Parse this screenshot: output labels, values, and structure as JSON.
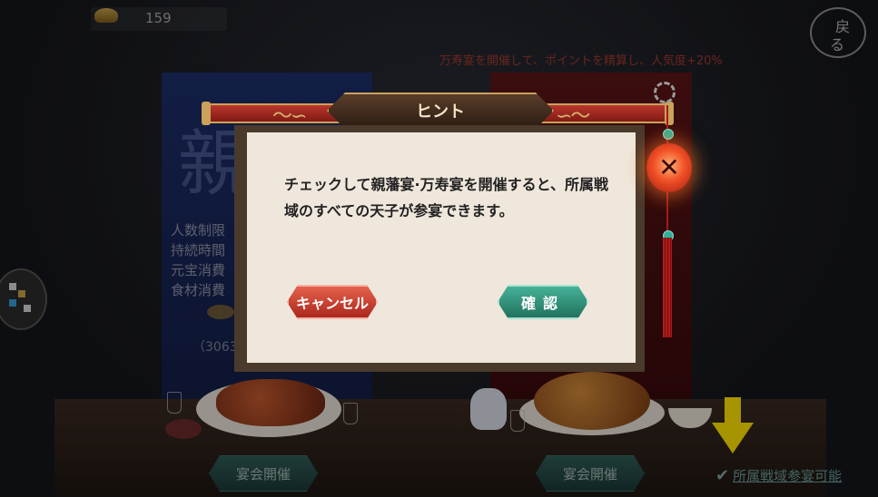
{
  "topbar": {
    "currency_value": "159",
    "notice": "万寿宴を開催して、ポイントを精算し、人気度+20%",
    "back_button_glyphs": [
      "戻",
      "る"
    ]
  },
  "banner_left": {
    "big_glyph": "親",
    "stats": [
      "人数制限",
      "持続時間",
      "元宝消費",
      "食材消費"
    ],
    "count": "（3063"
  },
  "dialog": {
    "title": "ヒント",
    "message": "チェックして親藩宴·万寿宴を開催すると、所属戦域のすべての天子が参宴できます。",
    "cancel_label": "キャンセル",
    "confirm_label": "確認",
    "close_glyph": "✕"
  },
  "bottom": {
    "open_button_left": "宴会開催",
    "open_button_right": "宴会開催",
    "checkbox_label": "所属戦域参宴可能",
    "checkbox_checked": true
  },
  "colors": {
    "accent_gold": "#caa25a",
    "cancel_red": "#c33a2a",
    "confirm_green": "#2f8f78",
    "highlight_arrow": "#ffe400"
  }
}
